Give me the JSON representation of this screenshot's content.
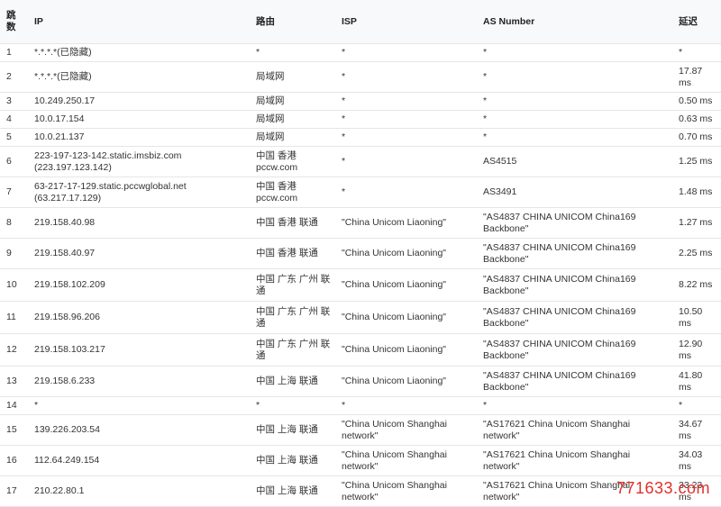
{
  "headers": {
    "hop": "跳\n数",
    "ip": "IP",
    "route": "路由",
    "isp": "ISP",
    "as": "AS Number",
    "latency": "延迟"
  },
  "rows": [
    {
      "hop": "1",
      "ip": "*.*.*.*(已隐藏)",
      "route": "*",
      "isp": "*",
      "as": "*",
      "latency": "*"
    },
    {
      "hop": "2",
      "ip": "*.*.*.*(已隐藏)",
      "route": "局域网",
      "isp": "*",
      "as": "*",
      "latency": "17.87\nms"
    },
    {
      "hop": "3",
      "ip": "10.249.250.17",
      "route": "局域网",
      "isp": "*",
      "as": "*",
      "latency": "0.50 ms"
    },
    {
      "hop": "4",
      "ip": "10.0.17.154",
      "route": "局域网",
      "isp": "*",
      "as": "*",
      "latency": "0.63 ms"
    },
    {
      "hop": "5",
      "ip": "10.0.21.137",
      "route": "局域网",
      "isp": "*",
      "as": "*",
      "latency": "0.70 ms"
    },
    {
      "hop": "6",
      "ip": "223-197-123-142.static.imsbiz.com\n(223.197.123.142)",
      "route": "中国 香港\npccw.com",
      "isp": "*",
      "as": "AS4515",
      "latency": "1.25 ms"
    },
    {
      "hop": "7",
      "ip": "63-217-17-129.static.pccwglobal.net\n(63.217.17.129)",
      "route": "中国 香港\npccw.com",
      "isp": "*",
      "as": "AS3491",
      "latency": "1.48 ms"
    },
    {
      "hop": "8",
      "ip": "219.158.40.98",
      "route": "中国 香港 联通",
      "isp": "\"China Unicom Liaoning\"",
      "as": "\"AS4837 CHINA UNICOM China169\nBackbone\"",
      "latency": "1.27 ms"
    },
    {
      "hop": "9",
      "ip": "219.158.40.97",
      "route": "中国 香港 联通",
      "isp": "\"China Unicom Liaoning\"",
      "as": "\"AS4837 CHINA UNICOM China169\nBackbone\"",
      "latency": "2.25 ms"
    },
    {
      "hop": "10",
      "ip": "219.158.102.209",
      "route": "中国 广东 广州 联\n通",
      "isp": "\"China Unicom Liaoning\"",
      "as": "\"AS4837 CHINA UNICOM China169\nBackbone\"",
      "latency": "8.22 ms"
    },
    {
      "hop": "11",
      "ip": "219.158.96.206",
      "route": "中国 广东 广州 联\n通",
      "isp": "\"China Unicom Liaoning\"",
      "as": "\"AS4837 CHINA UNICOM China169\nBackbone\"",
      "latency": "10.50\nms"
    },
    {
      "hop": "12",
      "ip": "219.158.103.217",
      "route": "中国 广东 广州 联\n通",
      "isp": "\"China Unicom Liaoning\"",
      "as": "\"AS4837 CHINA UNICOM China169\nBackbone\"",
      "latency": "12.90\nms"
    },
    {
      "hop": "13",
      "ip": "219.158.6.233",
      "route": "中国 上海 联通",
      "isp": "\"China Unicom Liaoning\"",
      "as": "\"AS4837 CHINA UNICOM China169\nBackbone\"",
      "latency": "41.80\nms"
    },
    {
      "hop": "14",
      "ip": "*",
      "route": "*",
      "isp": "*",
      "as": "*",
      "latency": "*"
    },
    {
      "hop": "15",
      "ip": "139.226.203.54",
      "route": "中国 上海 联通",
      "isp": "\"China Unicom Shanghai\nnetwork\"",
      "as": "\"AS17621 China Unicom Shanghai network\"",
      "latency": "34.67\nms"
    },
    {
      "hop": "16",
      "ip": "112.64.249.154",
      "route": "中国 上海 联通",
      "isp": "\"China Unicom Shanghai\nnetwork\"",
      "as": "\"AS17621 China Unicom Shanghai network\"",
      "latency": "34.03\nms"
    },
    {
      "hop": "17",
      "ip": "210.22.80.1",
      "route": "中国 上海 联通",
      "isp": "\"China Unicom Shanghai\nnetwork\"",
      "as": "\"AS17621 China Unicom Shanghai network\"",
      "latency": "33.23\nms"
    }
  ],
  "watermark": "771633.com",
  "colors": {
    "header_bg": "#f8f9fa",
    "border": "#e6e6e6",
    "watermark": "#e0312a"
  }
}
